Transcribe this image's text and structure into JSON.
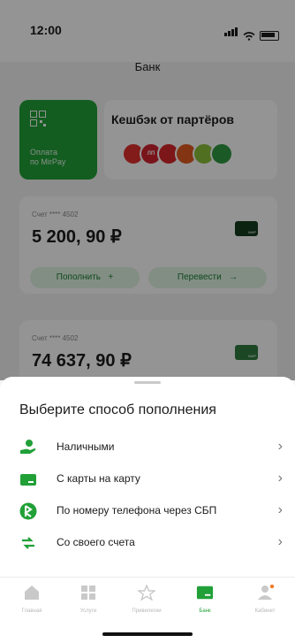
{
  "status_bar": {
    "time": "12:00"
  },
  "header": {
    "title": "Банк"
  },
  "mir_pay": {
    "label_line1": "Оплата",
    "label_line2": "по MirPay"
  },
  "cashback": {
    "title": "Кешбэк от партёров",
    "logos": [
      {
        "text": "",
        "color": "#e0312e"
      },
      {
        "text": "ЛП",
        "color": "#d1242f"
      },
      {
        "text": "",
        "color": "#d7262a"
      },
      {
        "text": "",
        "color": "#e25b22"
      },
      {
        "text": "",
        "color": "#8bbf3a"
      },
      {
        "text": "",
        "color": "#2f9a43"
      }
    ]
  },
  "accounts": [
    {
      "number": "Счет **** 4502",
      "balance": "5 200, 90 ₽",
      "topup_label": "Пополнить",
      "transfer_label": "Перевести"
    },
    {
      "number": "Счет **** 4502",
      "balance": "74 637, 90 ₽"
    }
  ],
  "sheet": {
    "title": "Выберите способ пополнения",
    "options": [
      {
        "label": "Наличными",
        "icon": "cash-hand-icon"
      },
      {
        "label": "С карты на карту",
        "icon": "card-icon"
      },
      {
        "label": "По номеру телефона через  СБП",
        "icon": "sbp-icon"
      },
      {
        "label": "Со своего счета",
        "icon": "transfer-arrows-icon"
      }
    ]
  },
  "tabbar": {
    "tabs": [
      {
        "label": "Главная",
        "icon": "home-icon",
        "active": false
      },
      {
        "label": "Услуги",
        "icon": "grid-icon",
        "active": false
      },
      {
        "label": "Привилегии",
        "icon": "star-icon",
        "active": false
      },
      {
        "label": "Банк",
        "icon": "bank-card-icon",
        "active": true
      },
      {
        "label": "Кабинет",
        "icon": "profile-icon",
        "active": false
      }
    ]
  },
  "colors": {
    "accent": "#21a038",
    "dim_overlay": "rgba(0,0,0,0.42)",
    "notification_dot": "#f07a28"
  }
}
